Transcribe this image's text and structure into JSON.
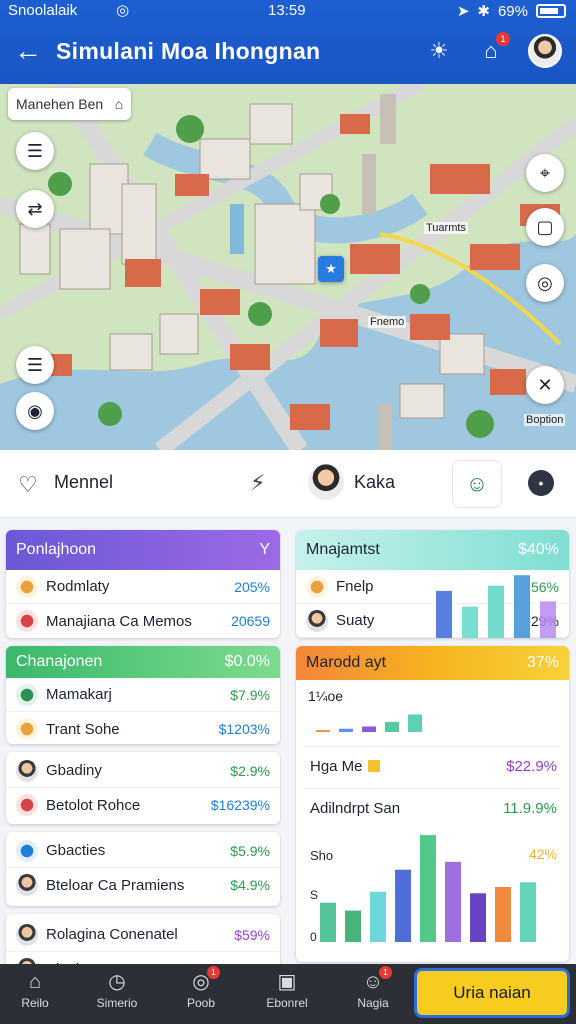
{
  "status": {
    "carrier": "Snoolalaik",
    "time": "13:59",
    "battery": "69%"
  },
  "header": {
    "title": "Simulani Moa  Ihongnan"
  },
  "map": {
    "search_label": "Manehen Ben",
    "labels": [
      "Tuarmts",
      "Fnemo",
      "Boption"
    ]
  },
  "userbar": {
    "left_name": "Mennel",
    "user_name": "Kaka"
  },
  "cards": {
    "purple": {
      "title": "Ponlajhoon",
      "value": "Y",
      "rows": [
        {
          "name": "Rodmlaty",
          "val": "205%"
        },
        {
          "name": "Manajiana Ca Memos",
          "val": "20659"
        }
      ]
    },
    "teal": {
      "title": "Mnajamtst",
      "value": "$40%",
      "rows": [
        {
          "name": "Fnelp",
          "val": "56%"
        },
        {
          "name": "Suaty",
          "val": "29%"
        }
      ]
    },
    "green": {
      "title": "Chanajonen",
      "value": "$0.0%",
      "rows": [
        {
          "name": "Mamakarj",
          "val": "$7.9%"
        },
        {
          "name": "Trant Sohe",
          "val": "$1203%"
        }
      ]
    },
    "white1": {
      "rows": [
        {
          "name": "Gbadiny",
          "val": "$2.9%"
        },
        {
          "name": "Betolot Rohce",
          "val": "$16239%"
        }
      ]
    },
    "white2": {
      "rows": [
        {
          "name": "Gbacties",
          "val": "$5.9%"
        },
        {
          "name": "Bteloar Ca Pramiens",
          "val": "$4.9%"
        }
      ]
    },
    "white3": {
      "rows": [
        {
          "name": "Rolagina Conenatel",
          "val": "$59%"
        },
        {
          "name": "Pianl",
          "val": ""
        }
      ]
    }
  },
  "chartcard": {
    "title": "Marodd ayt",
    "value": "37%",
    "label1": "1¼oe",
    "row2_label": "Hga Me",
    "row2_val": "$22.9%",
    "row3_label": "Adilndrpt San",
    "row3_val": "11.9.9%",
    "row4_label": "Sho",
    "row4_val": "42%",
    "axis_s": "S",
    "axis_0": "0"
  },
  "chart_data": [
    {
      "type": "bar",
      "title": "",
      "values": [
        4,
        7,
        12,
        22,
        38
      ],
      "colors": [
        "#f08a3a",
        "#5b8ff9",
        "#8e59d6",
        "#56c8a4",
        "#5ed0b6"
      ],
      "ylim": [
        0,
        100
      ]
    },
    {
      "type": "bar",
      "title": "",
      "values": [
        50,
        40,
        64,
        92,
        136,
        102,
        62,
        70,
        76
      ],
      "colors": [
        "#56c49a",
        "#49b37a",
        "#6fd6dc",
        "#4f6fd8",
        "#52c98a",
        "#9c6ee0",
        "#6a42c4",
        "#f08a3a",
        "#63d4b8",
        "#5b8ff9"
      ],
      "ylim": [
        0,
        140
      ]
    },
    {
      "type": "bar",
      "title": "",
      "values": [
        90,
        60,
        100,
        120,
        70
      ],
      "colors": [
        "#3c69d8",
        "#62d8c8",
        "#5ed3c2",
        "#3a8fd8",
        "#b58cf0"
      ],
      "ylim": [
        0,
        130
      ]
    }
  ],
  "bottomnav": {
    "items": [
      {
        "label": "Reilo"
      },
      {
        "label": "Simerio"
      },
      {
        "label": "Poob",
        "badge": "1"
      },
      {
        "label": "Ebonrel"
      },
      {
        "label": "Nagia",
        "badge": "1"
      }
    ],
    "cta": "Uria naian"
  }
}
